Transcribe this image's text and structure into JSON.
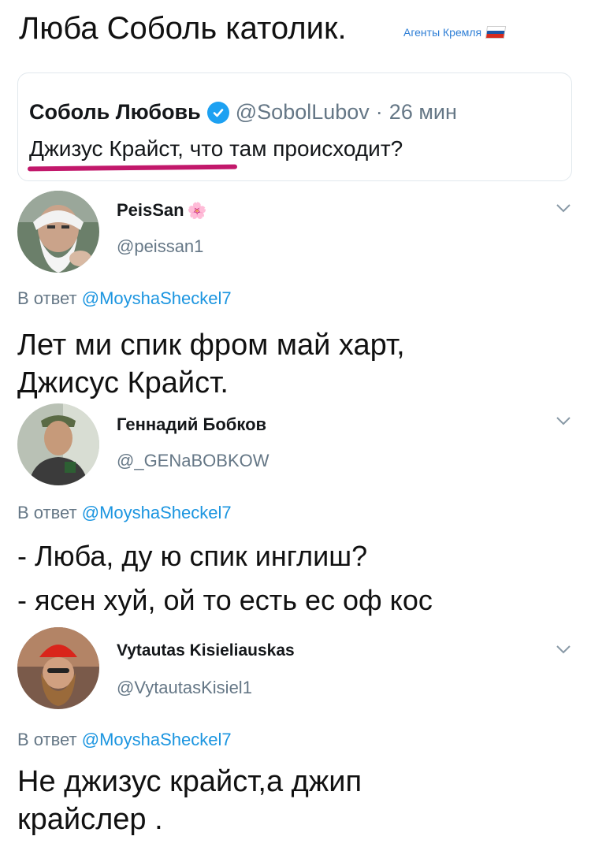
{
  "header": {
    "title": "Люба Соболь католик.",
    "watermark": "Агенты Кремля",
    "flag_colors": [
      "#ffffff",
      "#1c57a5",
      "#d52b1e"
    ]
  },
  "quoted_tweet": {
    "name": "Соболь Любовь",
    "handle": "@SobolLubov",
    "separator": "·",
    "time": "26 мин",
    "text": "Джизус Крайст, что там происходит?",
    "verified_icon": "verified-badge-icon",
    "underline_color": "#c2186b"
  },
  "replies": [
    {
      "name": "PeisSan",
      "name_emoji": "🌸",
      "handle": "@peissan1",
      "reply_prefix": "В ответ",
      "reply_to": "@MoyshaSheckel7",
      "text_lines": [
        "Лет ми спик фром май харт,",
        "Джисус Крайст."
      ]
    },
    {
      "name": "Геннадий Бобков",
      "handle": "@_GENaBOBKOW",
      "reply_prefix": "В ответ",
      "reply_to": "@MoyshaSheckel7",
      "text_lines": [
        "- Люба, ду ю спик инглиш?",
        "- ясен хуй, ой то есть ес оф кос"
      ]
    },
    {
      "name": "Vytautas Kisieliauskas",
      "handle": "@VytautasKisiel1",
      "reply_prefix": "В ответ",
      "reply_to": "@MoyshaSheckel7",
      "text_lines": [
        "Не джизус крайст,а джип",
        "крайслер ."
      ]
    }
  ],
  "colors": {
    "link": "#1b95e0",
    "secondary": "#657786",
    "verified": "#1da1f2"
  }
}
